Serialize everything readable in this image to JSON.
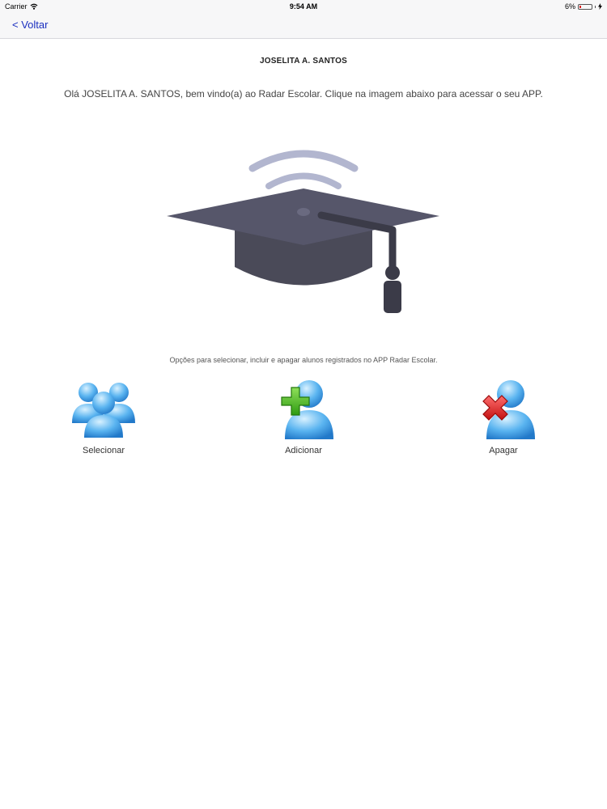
{
  "status_bar": {
    "carrier": "Carrier",
    "time": "9:54 AM",
    "battery": "6%"
  },
  "nav": {
    "back_label": "< Voltar"
  },
  "header": {
    "title": "JOSELITA A. SANTOS",
    "welcome": "Olá JOSELITA A. SANTOS, bem vindo(a) ao Radar Escolar. Clique na imagem abaixo para acessar o seu APP."
  },
  "options": {
    "label": "Opções para selecionar, incluir e apagar alunos registrados no APP Radar Escolar.",
    "select_label": "Selecionar",
    "add_label": "Adicionar",
    "delete_label": "Apagar"
  }
}
